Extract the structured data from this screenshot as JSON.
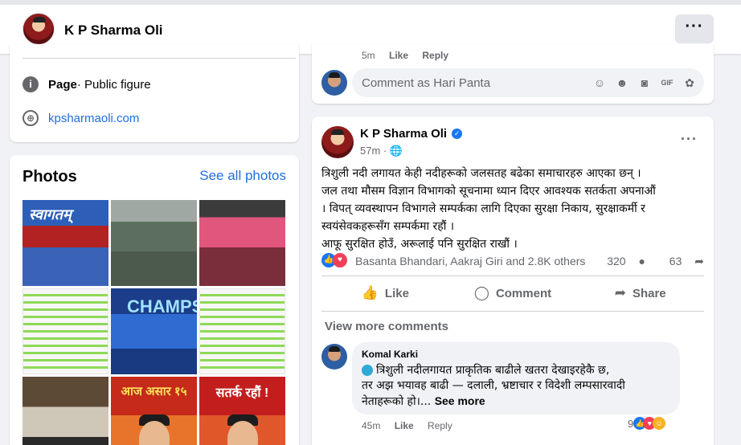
{
  "topbar": {
    "page_name": "K P Sharma Oli",
    "more_label": "···"
  },
  "intro": {
    "category_bold": "Page",
    "category_rest": " · Public figure",
    "website": "kpsharmaoli.com"
  },
  "photos": {
    "title": "Photos",
    "see_all": "See all photos",
    "tiles": [
      {
        "caption": "स्वागतम्"
      },
      {
        "caption": ""
      },
      {
        "caption": ""
      },
      {
        "caption": ""
      },
      {
        "caption": "CHAMPS"
      },
      {
        "caption": ""
      },
      {
        "caption": ""
      },
      {
        "caption": "आज असार १५"
      },
      {
        "caption": "सतर्क रहौं !"
      }
    ]
  },
  "comment_box": {
    "prev_time": "5m",
    "prev_like": "Like",
    "prev_reply": "Reply",
    "placeholder": "Comment as Hari Panta"
  },
  "post": {
    "author": "K P Sharma Oli",
    "time": "57m · ",
    "text_lines": [
      "त्रिशुली नदी लगायत केही नदीहरूको जलसतह बढेका समाचारहरु आएका छन् ।",
      "जल तथा मौसम विज्ञान विभागको सूचनामा ध्यान दिएर आवश्यक सतर्कता अपनाऔं",
      "। विपत् व्यवस्थापन विभागले सम्पर्कका लागि दिएका सुरक्षा निकाय, सुरक्षाकर्मी र",
      "स्वयंसेवकहरूसँग सम्पर्कमा रहौं ।",
      "आफू सुरक्षित होउँ, अरूलाई पनि सुरक्षित राखौं ।"
    ],
    "reaction_names": "Basanta Bhandari, Aakraj Giri and 2.8K others",
    "comment_count": "320",
    "share_count": "63",
    "actions": {
      "like": "Like",
      "comment": "Comment",
      "share": "Share"
    },
    "view_more": "View more comments",
    "reply": {
      "name": "Komal Karki",
      "line1": "त्रिशुली नदीलगायत प्राकृतिक बाढीले खतरा देखाइरहेकै छ,",
      "line2": "तर अझ भयावह बाढी — दलाली, भ्रष्टाचार र विदेशी लम्पसारवादी",
      "line3": "नेताहरूको हो।...",
      "see_more": "See more",
      "time": "45m",
      "like": "Like",
      "reply": "Reply",
      "react_count": "9"
    }
  }
}
